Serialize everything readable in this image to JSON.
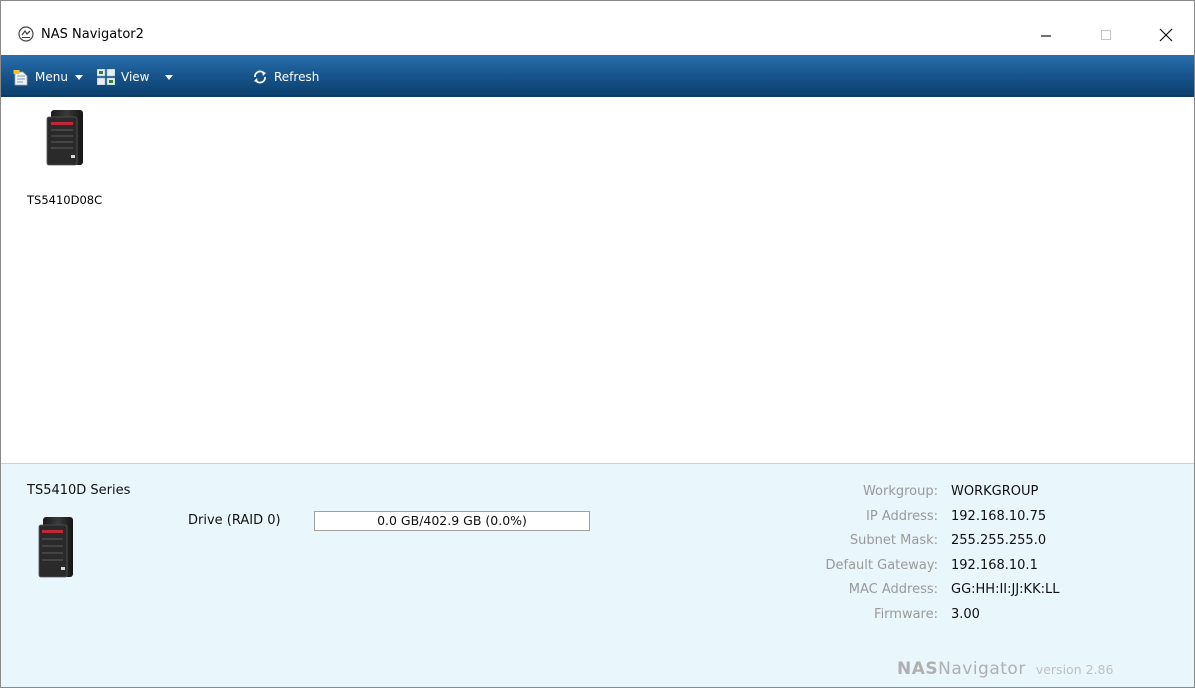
{
  "window": {
    "title": "NAS Navigator2",
    "icon": "nas-navigator-icon",
    "controls": {
      "minimize": "minimize-icon",
      "maximize": "maximize-icon",
      "close": "close-icon"
    }
  },
  "toolbar": {
    "menu_label": "Menu",
    "view_label": "View",
    "refresh_label": "Refresh"
  },
  "devices": [
    {
      "name": "TS5410D08C",
      "icon": "nas-device-icon"
    }
  ],
  "details": {
    "series": "TS5410D Series",
    "drive_label": "Drive (RAID 0)",
    "drive_usage": "0.0 GB/402.9 GB (0.0%)",
    "drive_used_fraction": 0.0,
    "info": [
      {
        "key": "Workgroup:",
        "value": "WORKGROUP"
      },
      {
        "key": "IP Address:",
        "value": "192.168.10.75"
      },
      {
        "key": "Subnet Mask:",
        "value": "255.255.255.0"
      },
      {
        "key": "Default Gateway:",
        "value": "192.168.10.1"
      },
      {
        "key": "MAC Address:",
        "value": "GG:HH:II:JJ:KK:LL"
      },
      {
        "key": "Firmware:",
        "value": "3.00"
      }
    ],
    "brand_prefix": "NAS",
    "brand_name": "Navigator",
    "version": "version 2.86"
  },
  "colors": {
    "toolbar_top": "#2a6fae",
    "toolbar_bottom": "#0c416f",
    "details_bg": "#e9f6fb",
    "label_gray": "#9a9a9a"
  }
}
